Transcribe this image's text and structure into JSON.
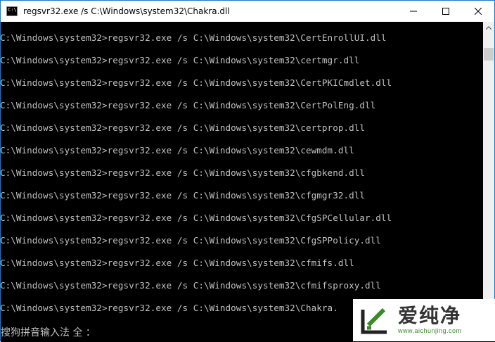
{
  "window": {
    "title": "regsvr32.exe  /s C:\\Windows\\system32\\Chakra.dll",
    "icon_label": "C:\\"
  },
  "console": {
    "lines": [
      "C:\\Windows\\system32>regsvr32.exe /s C:\\Windows\\system32\\CertEnrollUI.dll",
      "C:\\Windows\\system32>regsvr32.exe /s C:\\Windows\\system32\\certmgr.dll",
      "C:\\Windows\\system32>regsvr32.exe /s C:\\Windows\\system32\\CertPKICmdlet.dll",
      "C:\\Windows\\system32>regsvr32.exe /s C:\\Windows\\system32\\CertPolEng.dll",
      "C:\\Windows\\system32>regsvr32.exe /s C:\\Windows\\system32\\certprop.dll",
      "C:\\Windows\\system32>regsvr32.exe /s C:\\Windows\\system32\\cewmdm.dll",
      "C:\\Windows\\system32>regsvr32.exe /s C:\\Windows\\system32\\cfgbkend.dll",
      "C:\\Windows\\system32>regsvr32.exe /s C:\\Windows\\system32\\cfgmgr32.dll",
      "C:\\Windows\\system32>regsvr32.exe /s C:\\Windows\\system32\\CfgSPCellular.dll",
      "C:\\Windows\\system32>regsvr32.exe /s C:\\Windows\\system32\\CfgSPPolicy.dll",
      "C:\\Windows\\system32>regsvr32.exe /s C:\\Windows\\system32\\cfmifs.dll",
      "C:\\Windows\\system32>regsvr32.exe /s C:\\Windows\\system32\\cfmifsproxy.dll",
      "C:\\Windows\\system32>regsvr32.exe /s C:\\Windows\\system32\\Chakra."
    ]
  },
  "ime": {
    "status_text": "搜狗拼音输入法 全 ："
  },
  "watermark": {
    "brand": "爱纯净",
    "url": "www.aichunjing.com"
  },
  "colors": {
    "console_bg": "#000000",
    "console_text": "#c0c0c0",
    "titlebar_bg": "#ffffff",
    "window_border": "#1979ca",
    "watermark_green": "#3a8a2a"
  },
  "icons": {
    "app": "cmd-icon",
    "minimize": "minimize-icon",
    "maximize": "maximize-icon",
    "close": "close-icon",
    "scroll_up": "scroll-up-arrow-icon",
    "scroll_down": "scroll-down-arrow-icon",
    "watermark_logo": "aichunjing-logo-icon"
  }
}
